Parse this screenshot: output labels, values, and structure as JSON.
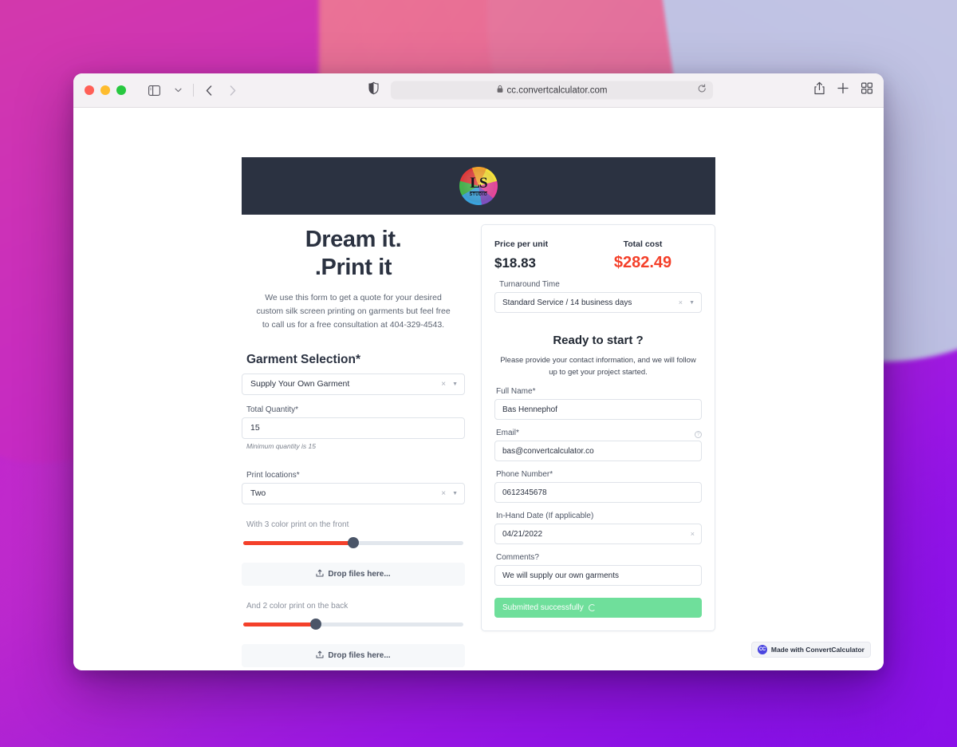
{
  "browser": {
    "url": "cc.convertcalculator.com",
    "icons": {
      "sidebar": "sidebar-icon",
      "chevron_down": "chevron-down-icon",
      "back": "back-arrow-icon",
      "forward": "forward-arrow-icon",
      "shield": "privacy-shield-icon",
      "lock": "lock-icon",
      "reload": "reload-icon",
      "share": "share-icon",
      "new_tab": "plus-icon",
      "tab_overview": "tab-overview-icon"
    }
  },
  "site_header": {
    "logo_initials": "LS",
    "logo_subtext": "STUDIO"
  },
  "hero": {
    "title_line1": "Dream it.",
    "title_line2": ".Print it",
    "subtitle": "We use this form to get a quote for your desired custom silk screen printing on garments but feel free to call us for a free consultation at 404-329-4543."
  },
  "form_left": {
    "garment_section_title": "Garment Selection*",
    "garment_select": {
      "value": "Supply Your Own Garment",
      "clear": "×",
      "caret": "▼"
    },
    "quantity": {
      "label": "Total Quantity*",
      "value": "15",
      "hint": "Minimum quantity is 15"
    },
    "print_locations": {
      "label": "Print locations*",
      "value": "Two",
      "clear": "×",
      "caret": "▼"
    },
    "front": {
      "label": "With 3 color print on the front",
      "slider_percent": 50,
      "dropzone_label": "Drop files here..."
    },
    "back": {
      "label": "And 2 color print on the back",
      "slider_percent": 33,
      "dropzone_label": "Drop files here..."
    }
  },
  "pricing": {
    "price_per_unit_label": "Price per unit",
    "price_per_unit_value": "$18.83",
    "total_cost_label": "Total cost",
    "total_cost_value": "$282.49",
    "total_cost_color": "#f4402a",
    "turnaround_label": "Turnaround Time",
    "turnaround_value": "Standard Service / 14 business days",
    "clear": "×",
    "caret": "▼"
  },
  "contact": {
    "heading": "Ready to start ?",
    "subtitle": "Please provide your contact information, and we will follow up to get your project started.",
    "fields": [
      {
        "label": "Full Name*",
        "value": "Bas Hennephof",
        "help": false,
        "clear": false
      },
      {
        "label": "Email*",
        "value": "bas@convertcalculator.co",
        "help": true,
        "clear": false
      },
      {
        "label": "Phone Number*",
        "value": "0612345678",
        "help": false,
        "clear": false
      },
      {
        "label": "In-Hand Date (If applicable)",
        "value": "04/21/2022",
        "help": false,
        "clear": true
      },
      {
        "label": "Comments?",
        "value": "We will supply our own garments",
        "help": false,
        "clear": false
      }
    ],
    "help_glyph": "?",
    "clear_glyph": "×",
    "submit_label": "Submitted successfully",
    "submit_color": "#6fdf9b"
  },
  "footer_badge": {
    "mark": "CC",
    "text": "Made with ConvertCalculator"
  }
}
